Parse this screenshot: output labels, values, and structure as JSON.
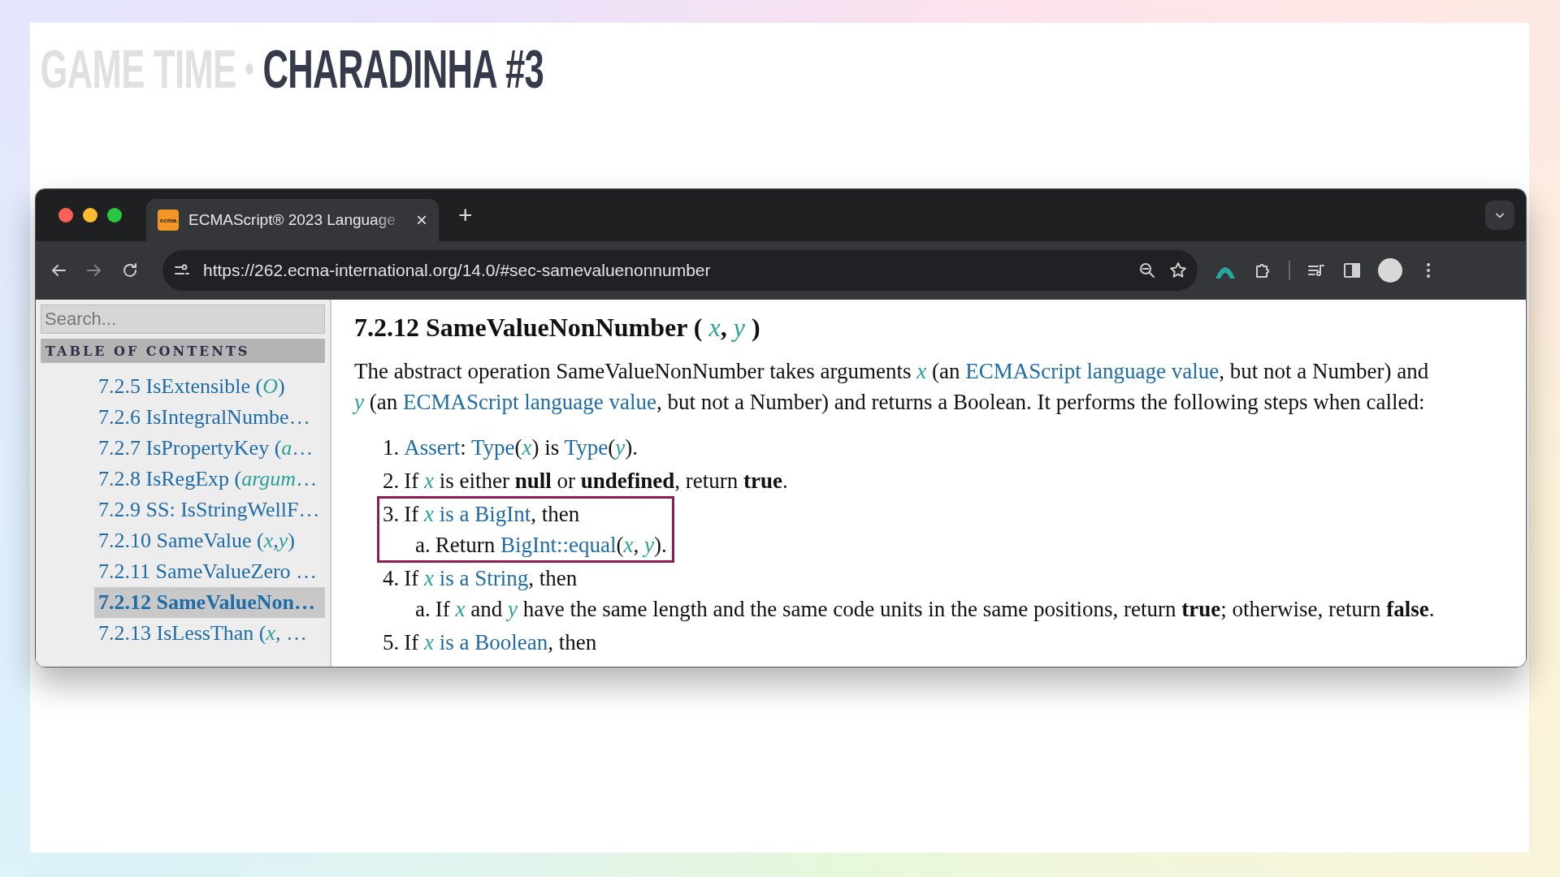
{
  "slide": {
    "title_prefix": "GAME TIME",
    "title": "CHARADINHA #3"
  },
  "browser": {
    "tab": {
      "favicon_text": "ecma",
      "title": "ECMAScript® 2023 Language",
      "close": "×"
    },
    "new_tab": "+",
    "forward_disabled": true,
    "url": "https://262.ecma-international.org/14.0/#sec-samevaluenonnumber"
  },
  "sidebar": {
    "search_placeholder": "Search...",
    "toc_title": "TABLE OF CONTENTS",
    "items": [
      {
        "selected": false,
        "segments": [
          {
            "kind": "text",
            "text": "7.2.5 IsExtensible ( "
          },
          {
            "kind": "var",
            "text": "O"
          },
          {
            "kind": "text",
            "text": " )"
          }
        ]
      },
      {
        "selected": false,
        "segments": [
          {
            "kind": "text",
            "text": "7.2.6 IsIntegralNumbe…"
          }
        ]
      },
      {
        "selected": false,
        "segments": [
          {
            "kind": "text",
            "text": "7.2.7 IsPropertyKey ( "
          },
          {
            "kind": "var",
            "text": "a"
          },
          {
            "kind": "text",
            "text": "…"
          }
        ]
      },
      {
        "selected": false,
        "segments": [
          {
            "kind": "text",
            "text": "7.2.8 IsRegExp ( "
          },
          {
            "kind": "var",
            "text": "argum"
          },
          {
            "kind": "text",
            "text": "…"
          }
        ]
      },
      {
        "selected": false,
        "segments": [
          {
            "kind": "text",
            "text": "7.2.9 SS: IsStringWellF…"
          }
        ]
      },
      {
        "selected": false,
        "segments": [
          {
            "kind": "text",
            "text": "7.2.10 SameValue ( "
          },
          {
            "kind": "var",
            "text": "x"
          },
          {
            "kind": "text",
            "text": ", "
          },
          {
            "kind": "var",
            "text": "y"
          },
          {
            "kind": "text",
            "text": " )"
          }
        ]
      },
      {
        "selected": false,
        "segments": [
          {
            "kind": "text",
            "text": "7.2.11 SameValueZero …"
          }
        ]
      },
      {
        "selected": true,
        "segments": [
          {
            "kind": "text",
            "text": "7.2.12 SameValueNon…"
          }
        ]
      },
      {
        "selected": false,
        "segments": [
          {
            "kind": "text",
            "text": "7.2.13 IsLessThan ( "
          },
          {
            "kind": "var",
            "text": "x"
          },
          {
            "kind": "text",
            "text": ", …"
          }
        ]
      }
    ]
  },
  "content": {
    "heading": [
      {
        "kind": "text",
        "text": "7.2.12  SameValueNonNumber ( "
      },
      {
        "kind": "var",
        "text": "x"
      },
      {
        "kind": "text",
        "text": ", "
      },
      {
        "kind": "var",
        "text": "y"
      },
      {
        "kind": "text",
        "text": " )"
      }
    ],
    "paragraph": [
      {
        "kind": "text",
        "text": "The abstract operation SameValueNonNumber takes arguments "
      },
      {
        "kind": "var",
        "text": "x"
      },
      {
        "kind": "text",
        "text": " (an "
      },
      {
        "kind": "link",
        "text": "ECMAScript language value"
      },
      {
        "kind": "text",
        "text": ", but not a Number) and "
      },
      {
        "kind": "var",
        "text": "y"
      },
      {
        "kind": "text",
        "text": " (an "
      },
      {
        "kind": "link",
        "text": "ECMAScript language value"
      },
      {
        "kind": "text",
        "text": ", but not a Number) and returns a Boolean. It performs the following steps when called:"
      }
    ],
    "steps": [
      {
        "marker": "1.",
        "highlighted": false,
        "segments": [
          {
            "kind": "link",
            "text": "Assert"
          },
          {
            "kind": "text",
            "text": ": "
          },
          {
            "kind": "link",
            "text": "Type"
          },
          {
            "kind": "text",
            "text": "("
          },
          {
            "kind": "var",
            "text": "x"
          },
          {
            "kind": "text",
            "text": ") is "
          },
          {
            "kind": "link",
            "text": "Type"
          },
          {
            "kind": "text",
            "text": "("
          },
          {
            "kind": "var",
            "text": "y"
          },
          {
            "kind": "text",
            "text": ")."
          }
        ]
      },
      {
        "marker": "2.",
        "highlighted": false,
        "segments": [
          {
            "kind": "text",
            "text": "If "
          },
          {
            "kind": "var",
            "text": "x"
          },
          {
            "kind": "text",
            "text": " is either "
          },
          {
            "kind": "bold",
            "text": "null"
          },
          {
            "kind": "text",
            "text": " or "
          },
          {
            "kind": "bold",
            "text": "undefined"
          },
          {
            "kind": "text",
            "text": ", return "
          },
          {
            "kind": "bold",
            "text": "true"
          },
          {
            "kind": "text",
            "text": "."
          }
        ]
      },
      {
        "marker": "3.",
        "highlighted": true,
        "segments": [
          {
            "kind": "text",
            "text": "If "
          },
          {
            "kind": "var",
            "text": "x"
          },
          {
            "kind": "link",
            "text": " is a BigInt"
          },
          {
            "kind": "text",
            "text": ", then"
          }
        ],
        "children": [
          {
            "marker": "a.",
            "segments": [
              {
                "kind": "text",
                "text": "Return "
              },
              {
                "kind": "link",
                "text": "BigInt::equal"
              },
              {
                "kind": "text",
                "text": "("
              },
              {
                "kind": "var",
                "text": "x"
              },
              {
                "kind": "text",
                "text": ", "
              },
              {
                "kind": "var",
                "text": "y"
              },
              {
                "kind": "text",
                "text": ")."
              }
            ]
          }
        ]
      },
      {
        "marker": "4.",
        "highlighted": false,
        "segments": [
          {
            "kind": "text",
            "text": "If "
          },
          {
            "kind": "var",
            "text": "x"
          },
          {
            "kind": "link",
            "text": " is a String"
          },
          {
            "kind": "text",
            "text": ", then"
          }
        ],
        "children": [
          {
            "marker": "a.",
            "segments": [
              {
                "kind": "text",
                "text": "If "
              },
              {
                "kind": "var",
                "text": "x"
              },
              {
                "kind": "text",
                "text": " and "
              },
              {
                "kind": "var",
                "text": "y"
              },
              {
                "kind": "text",
                "text": " have the same length and the same code units in the same positions, return "
              },
              {
                "kind": "bold",
                "text": "true"
              },
              {
                "kind": "text",
                "text": "; otherwise, return "
              },
              {
                "kind": "bold",
                "text": "false"
              },
              {
                "kind": "text",
                "text": "."
              }
            ]
          }
        ]
      },
      {
        "marker": "5.",
        "highlighted": false,
        "segments": [
          {
            "kind": "text",
            "text": "If "
          },
          {
            "kind": "var",
            "text": "x"
          },
          {
            "kind": "link",
            "text": " is a Boolean"
          },
          {
            "kind": "text",
            "text": ", then"
          }
        ]
      }
    ]
  }
}
